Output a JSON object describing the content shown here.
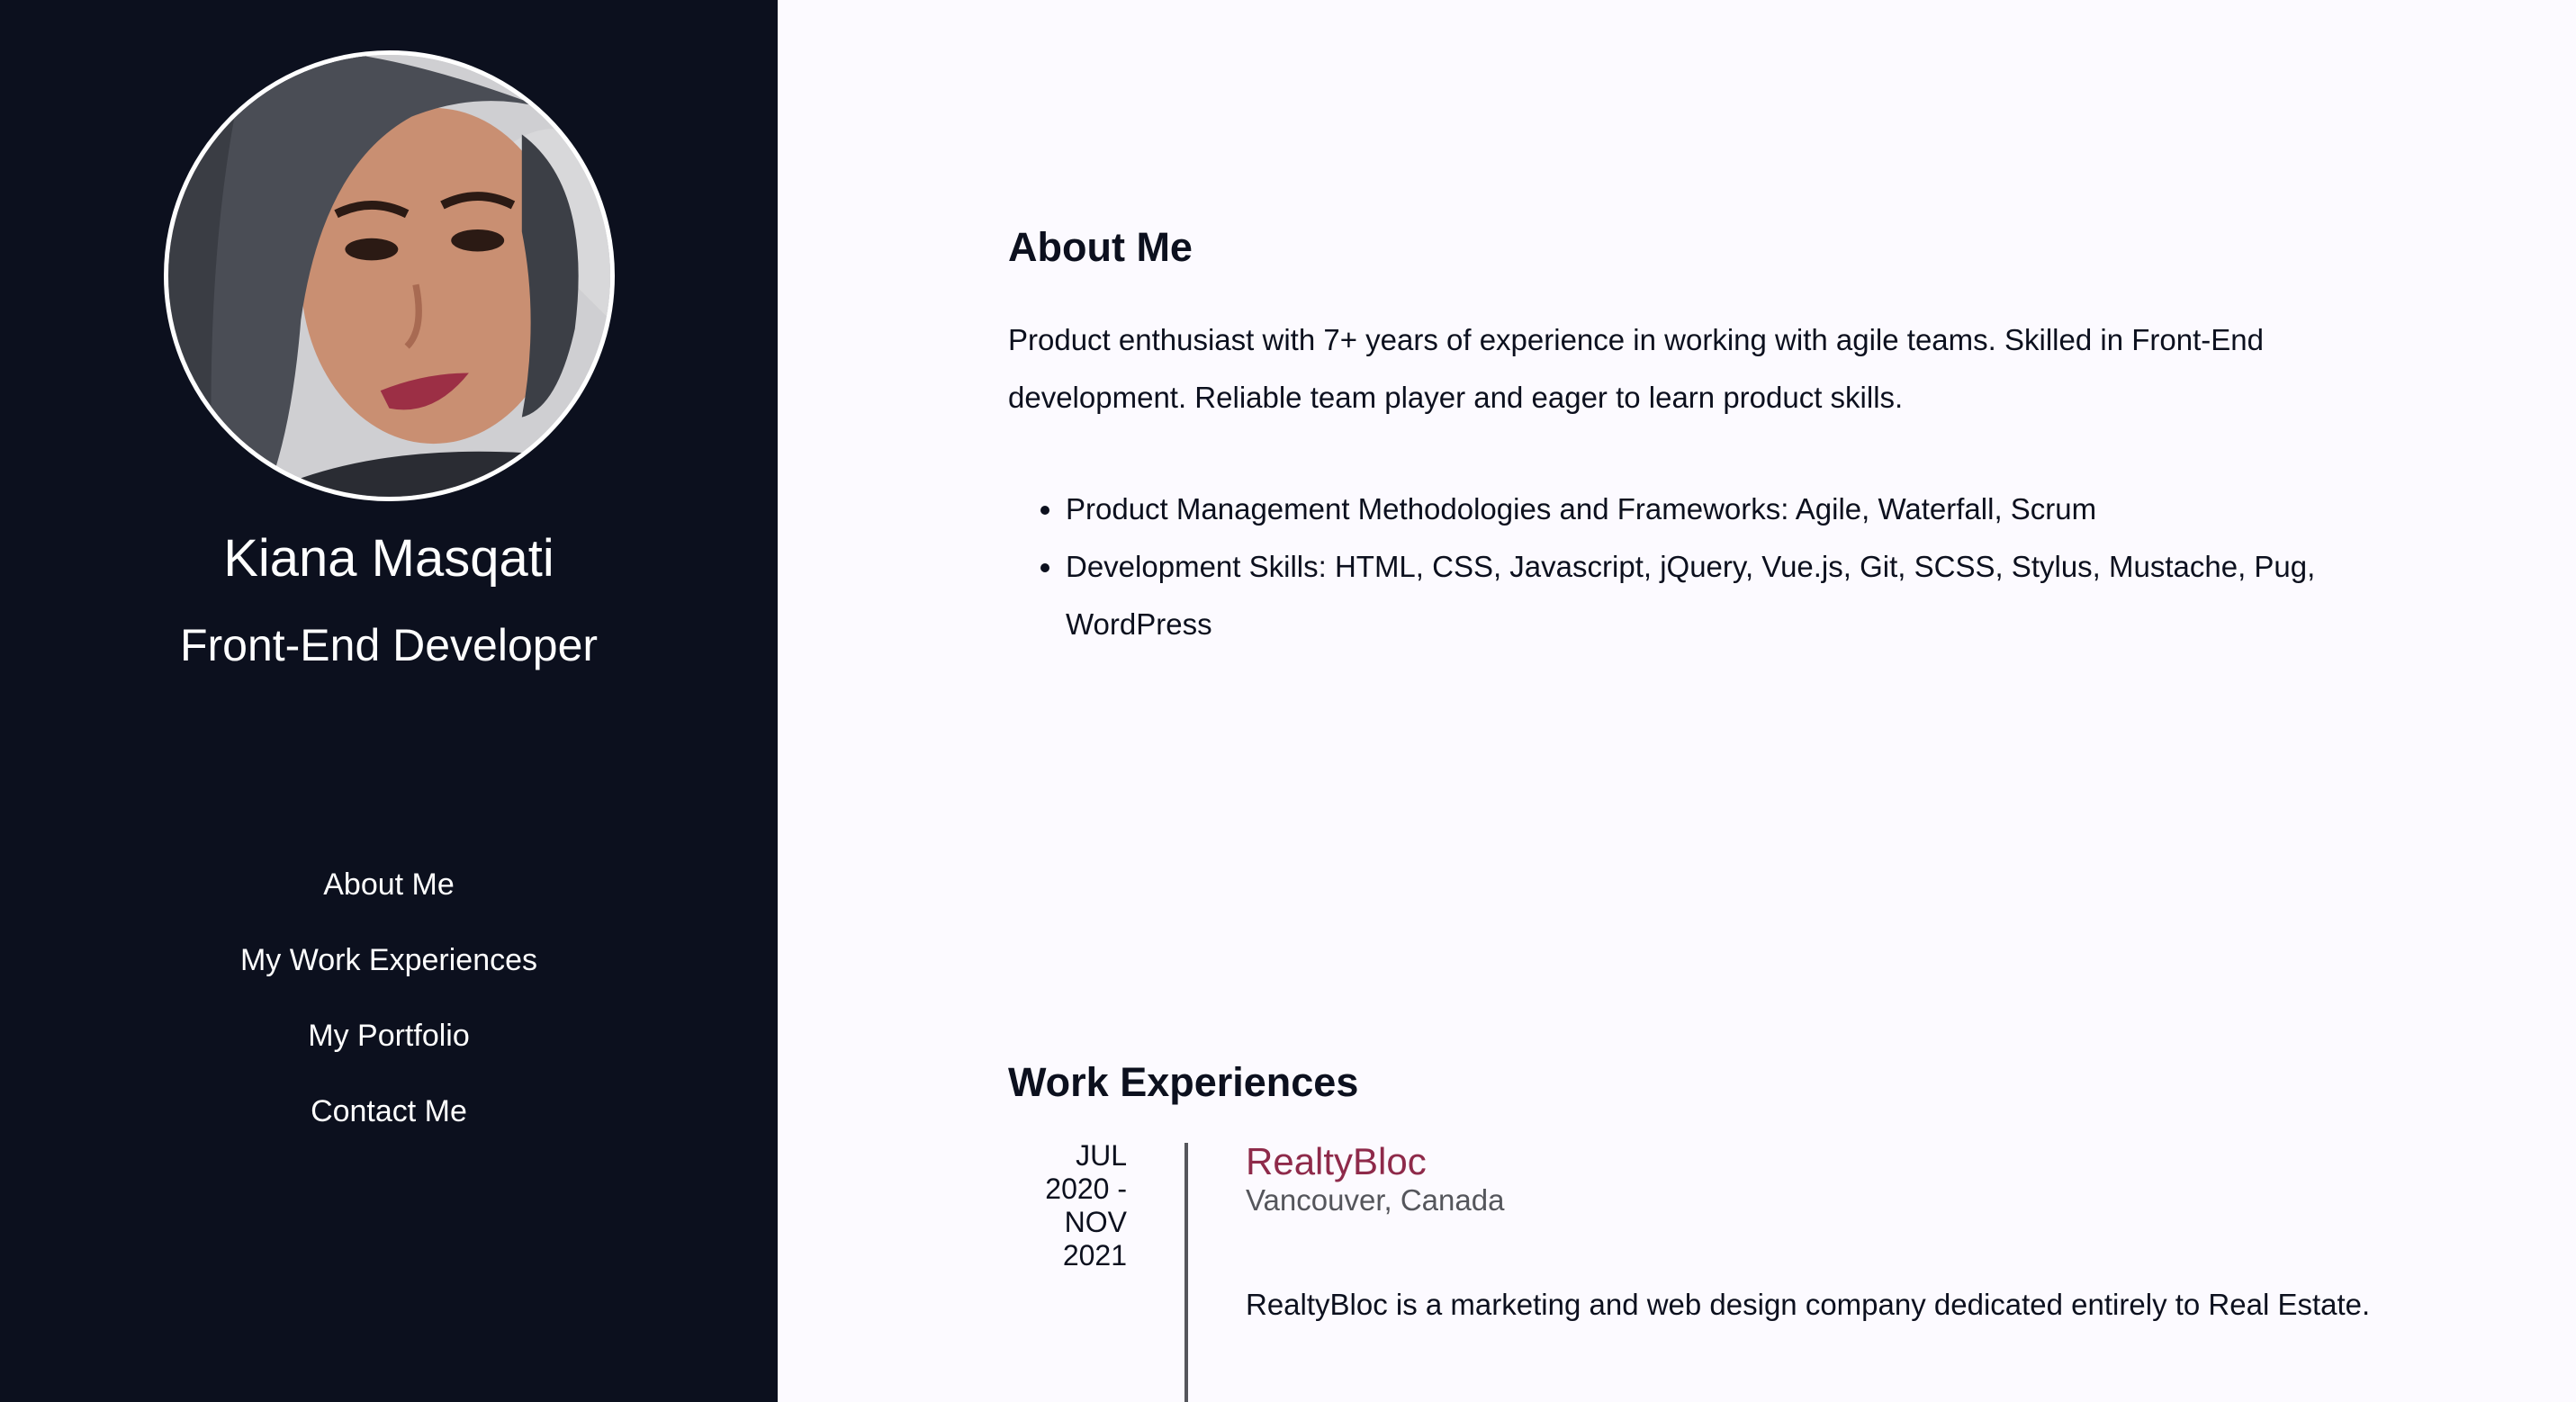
{
  "profile": {
    "name": "Kiana Masqati",
    "role": "Front-End Developer"
  },
  "nav": {
    "items": [
      {
        "label": "About Me"
      },
      {
        "label": "My Work Experiences"
      },
      {
        "label": "My Portfolio"
      },
      {
        "label": "Contact Me"
      }
    ]
  },
  "about": {
    "title": "About Me",
    "paragraph": "Product enthusiast with 7+ years of experience in working with agile teams. Skilled in Front-End development. Reliable team player and eager to learn product skills.",
    "skills": [
      "Product Management Methodologies and Frameworks: Agile, Waterfall, Scrum",
      "Development Skills: HTML, CSS, Javascript, jQuery, Vue.js, Git, SCSS, Stylus, Mustache, Pug, WordPress"
    ]
  },
  "work": {
    "title": "Work Experiences",
    "jobs": [
      {
        "date": "JUL\n2020 -\nNOV\n2021",
        "company": "RealtyBloc",
        "location": "Vancouver, Canada",
        "description": "RealtyBloc is a marketing and web design company dedicated entirely to Real Estate."
      }
    ]
  },
  "colors": {
    "sidebar_bg": "#0c101e",
    "page_bg": "#fcfaff",
    "accent": "#8e2a4a",
    "muted": "#55565c"
  }
}
